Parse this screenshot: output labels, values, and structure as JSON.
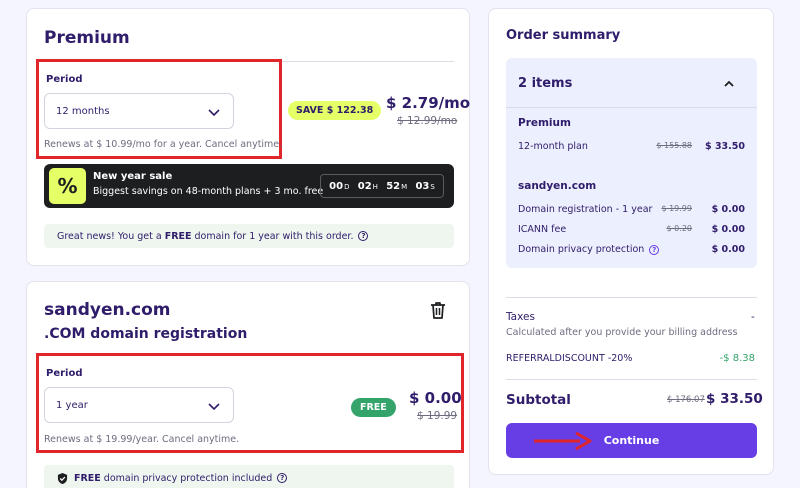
{
  "premium": {
    "title": "Premium",
    "period_label": "Period",
    "period_value": "12 months",
    "renew_note": "Renews at $ 10.99/mo for a year. Cancel anytime.",
    "save_badge": "SAVE $ 122.38",
    "price": "$ 2.79/mo",
    "old_price": "$ 12.99/mo",
    "sale": {
      "icon": "%",
      "title": "New year sale",
      "subtitle": "Biggest savings on 48-month plans + 3 mo. free",
      "countdown": [
        {
          "value": "00",
          "unit": "D"
        },
        {
          "value": "02",
          "unit": "H"
        },
        {
          "value": "52",
          "unit": "M"
        },
        {
          "value": "03",
          "unit": "S"
        }
      ]
    },
    "free_domain_note": {
      "pre": "Great news! You get a ",
      "bold": "FREE",
      "post": " domain for 1 year with this order."
    }
  },
  "domain": {
    "name": "sandyen.com",
    "subtitle": ".COM domain registration",
    "period_label": "Period",
    "period_value": "1 year",
    "renew_note": "Renews at $ 19.99/year. Cancel anytime.",
    "free_badge": "FREE",
    "price": "$ 0.00",
    "old_price": "$ 19.99",
    "privacy_note": {
      "bold": "FREE",
      "post": " domain privacy protection included"
    }
  },
  "summary": {
    "title": "Order summary",
    "items_count": "2 items",
    "sections": [
      {
        "title": "Premium",
        "lines": [
          {
            "label": "12-month plan",
            "old": "$ 155.88",
            "new": "$ 33.50"
          }
        ]
      },
      {
        "title": "sandyen.com",
        "lines": [
          {
            "label": "Domain registration - 1 year",
            "old": "$ 19.99",
            "new": "$ 0.00"
          },
          {
            "label": "ICANN fee",
            "old": "$ 0.20",
            "new": "$ 0.00"
          },
          {
            "label": "Domain privacy protection",
            "old": "",
            "new": "$ 0.00"
          }
        ]
      }
    ],
    "taxes_label": "Taxes",
    "taxes_value": "-",
    "taxes_note": "Calculated after you provide your billing address",
    "referral_label": "REFERRALDISCOUNT -20%",
    "referral_value": "-$ 8.38",
    "subtotal_label": "Subtotal",
    "subtotal_old": "$ 176.07",
    "subtotal_new": "$ 33.50",
    "continue_label": "Continue"
  },
  "colors": {
    "brand": "#673de6",
    "highlight_border": "#e0252b",
    "save_badge": "#e5ff66",
    "free_badge": "#35a46b"
  }
}
